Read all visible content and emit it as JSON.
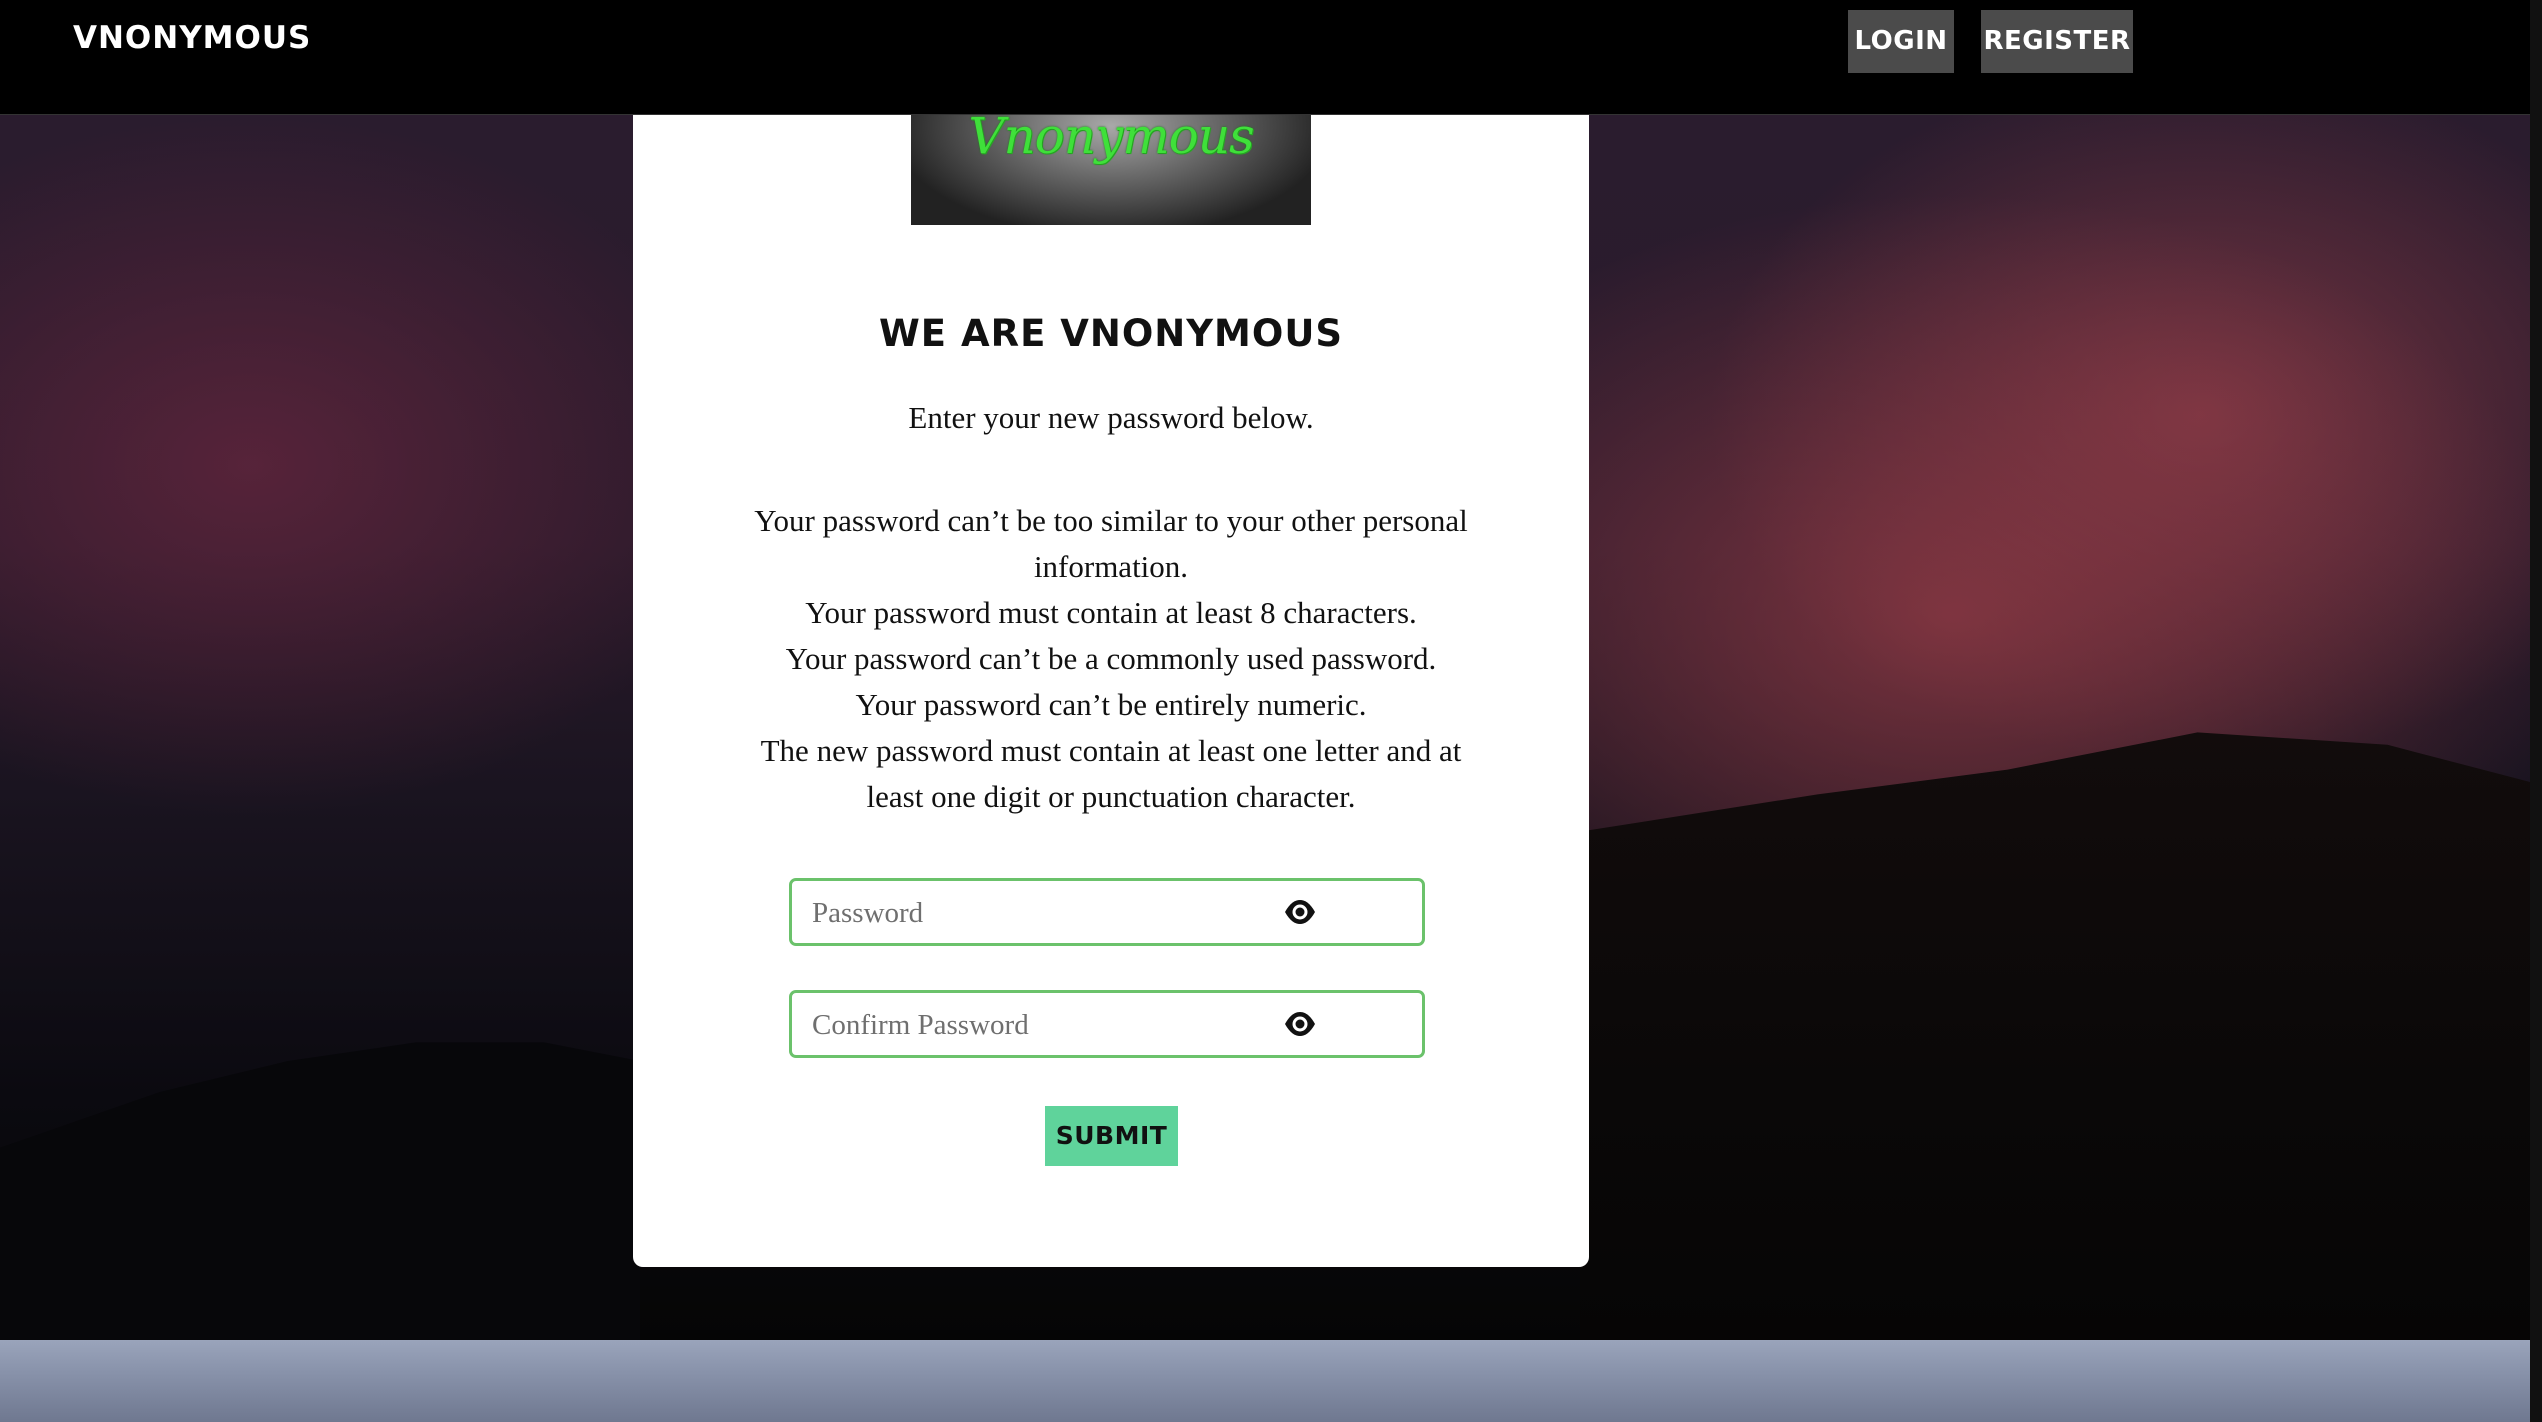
{
  "navbar": {
    "brand": "VNONYMOUS",
    "login_label": "LOGIN",
    "register_label": "REGISTER"
  },
  "card": {
    "logo_text": "Vnonymous",
    "title": "WE ARE VNONYMOUS",
    "subtitle": "Enter your new password below.",
    "help_lines": [
      "Your password can’t be too similar to your other personal information.",
      "Your password must contain at least 8 characters.",
      "Your password can’t be a commonly used password.",
      "Your password can’t be entirely numeric.",
      "The new password must contain at least one letter and at least one digit or punctuation character."
    ],
    "password": {
      "placeholder": "Password",
      "value": "",
      "icon": "eye-icon"
    },
    "confirm_password": {
      "placeholder": "Confirm Password",
      "value": "",
      "icon": "eye-icon"
    },
    "submit_label": "SUBMIT"
  },
  "colors": {
    "field_border": "#6bc26b",
    "submit_bg": "#5fd39b",
    "logo_text": "#3fe03a",
    "nav_button_bg": "#4b4b4b"
  }
}
